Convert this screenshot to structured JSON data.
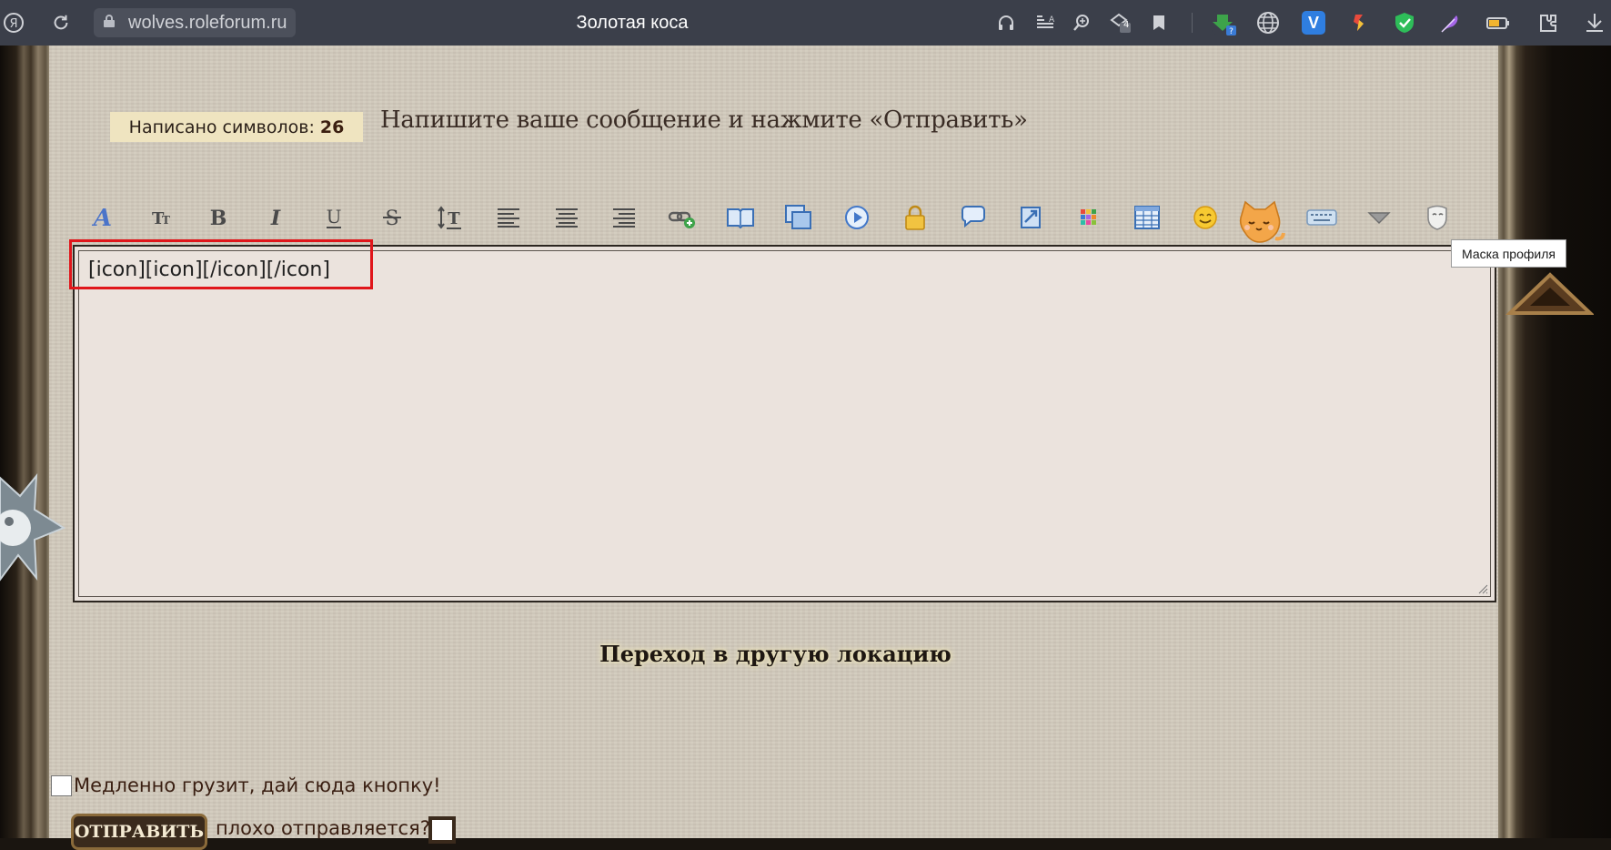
{
  "browser": {
    "url": "wolves.roleforum.ru",
    "title": "Золотая коса",
    "tab_count_badge": "4"
  },
  "editor": {
    "char_count_label": "Написано символов:",
    "char_count_value": "26",
    "instruction": "Напишите ваше сообщение и нажмите «Отправить»",
    "content": "[icon][icon][/icon][/icon]",
    "tooltip": "Маска профиля",
    "toolbar": [
      "font",
      "font-size",
      "bold",
      "italic",
      "underline",
      "strikethrough",
      "line-height",
      "align-left",
      "align-center",
      "align-right",
      "link",
      "quote-book",
      "image",
      "video",
      "hide",
      "speech",
      "spoiler",
      "color",
      "table",
      "smiley",
      "cat-smiley",
      "keyboard",
      "more",
      "mask"
    ]
  },
  "location_link": "Переход в другую локацию",
  "slow_load_label": "Медленно грузит, дай сюда кнопку!",
  "submit_label": "ОТПРАВИТЬ",
  "bad_send_label": "плохо отправляется?",
  "colors": {
    "highlight": "#e0161b",
    "page_bg": "#d1c9bb",
    "browser_bar": "#3b3f4a"
  }
}
